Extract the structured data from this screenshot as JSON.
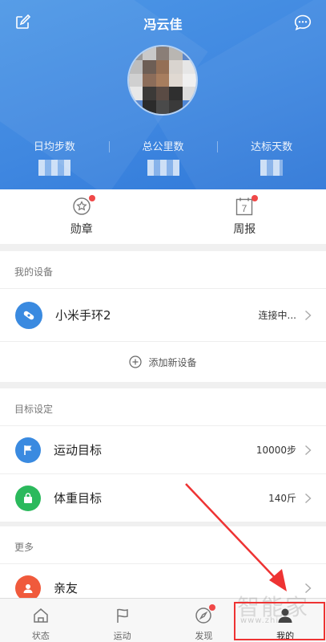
{
  "header": {
    "user_name": "冯云佳",
    "stats": [
      {
        "label": "日均步数"
      },
      {
        "label": "总公里数"
      },
      {
        "label": "达标天数"
      }
    ]
  },
  "quick": {
    "medal_label": "勋章",
    "weekly_label": "周报",
    "weekly_day": "7"
  },
  "devices": {
    "section_title": "我的设备",
    "device_name": "小米手环2",
    "device_status": "连接中...",
    "add_device_label": "添加新设备"
  },
  "goals": {
    "section_title": "目标设定",
    "items": [
      {
        "label": "运动目标",
        "value": "10000步"
      },
      {
        "label": "体重目标",
        "value": "140斤"
      }
    ]
  },
  "more": {
    "section_title": "更多",
    "items": [
      {
        "label": "亲友"
      }
    ]
  },
  "tabbar": {
    "tabs": [
      {
        "label": "状态"
      },
      {
        "label": "运动"
      },
      {
        "label": "发现"
      },
      {
        "label": "我的"
      }
    ]
  },
  "watermark": {
    "text": "智能家",
    "url": "www.zhi"
  },
  "colors": {
    "header_blue": "#3f87e0",
    "device_icon": "#3a8ae0",
    "goal_flag": "#3a8ae0",
    "goal_weight": "#2bb95c",
    "friends_icon": "#f05a3c",
    "red_dot": "#f04848"
  }
}
